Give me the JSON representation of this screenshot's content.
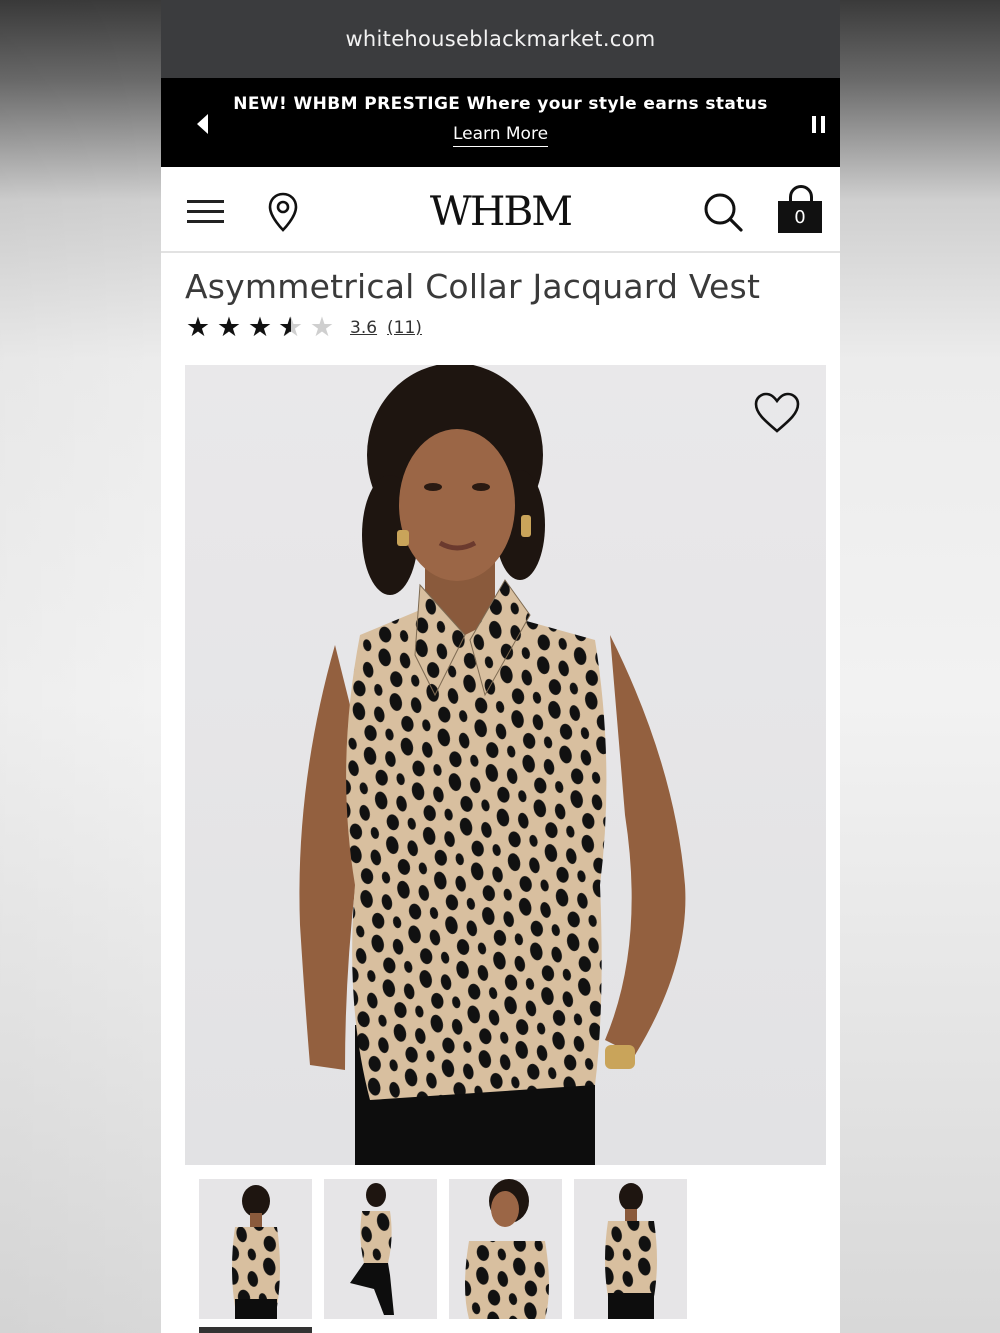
{
  "browser": {
    "url": "whitehouseblackmarket.com"
  },
  "promo": {
    "message": "NEW! WHBM PRESTIGE Where your style earns status",
    "link": "Learn More"
  },
  "header": {
    "logo": "WHBM",
    "cart_count": "0"
  },
  "product": {
    "title": "Asymmetrical Collar Jacquard Vest",
    "rating": 3.6,
    "rating_text": "3.6",
    "review_count": "(11)",
    "stars_max": 5
  },
  "gallery": {
    "thumbnails": [
      "front",
      "seated",
      "close-up",
      "back"
    ],
    "active_index": 0
  },
  "colors": {
    "promo_bg": "#000000",
    "urlbar_bg": "#3b3c3e",
    "vest_base": "#d8bf9f",
    "spot": "#111111"
  }
}
